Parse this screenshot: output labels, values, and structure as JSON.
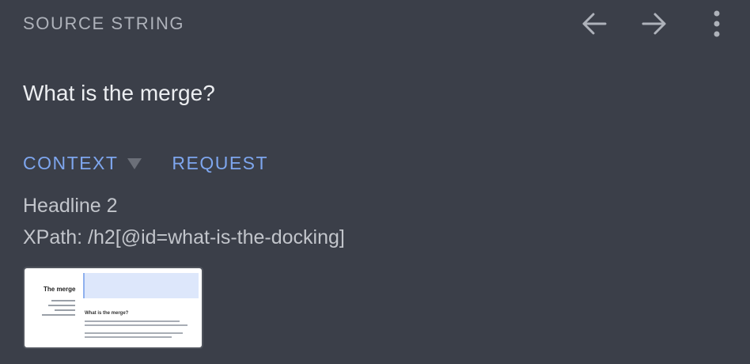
{
  "header": {
    "title": "SOURCE STRING",
    "icons": [
      "arrow-back-icon",
      "arrow-forward-icon",
      "more-vertical-icon"
    ]
  },
  "source": {
    "text": "What is the merge?"
  },
  "tabs": [
    {
      "label": "CONTEXT",
      "has_dropdown": true
    },
    {
      "label": "REQUEST"
    }
  ],
  "context": {
    "element_type": "Headline 2",
    "xpath": "XPath: /h2[@id=what-is-the-docking]"
  },
  "thumbnail": {
    "sidebar_title": "The merge",
    "main_heading": "What is the merge?"
  },
  "colors": {
    "background": "#3b3f49",
    "accent": "#7ea6ee",
    "muted_text": "#aeb2ba"
  }
}
